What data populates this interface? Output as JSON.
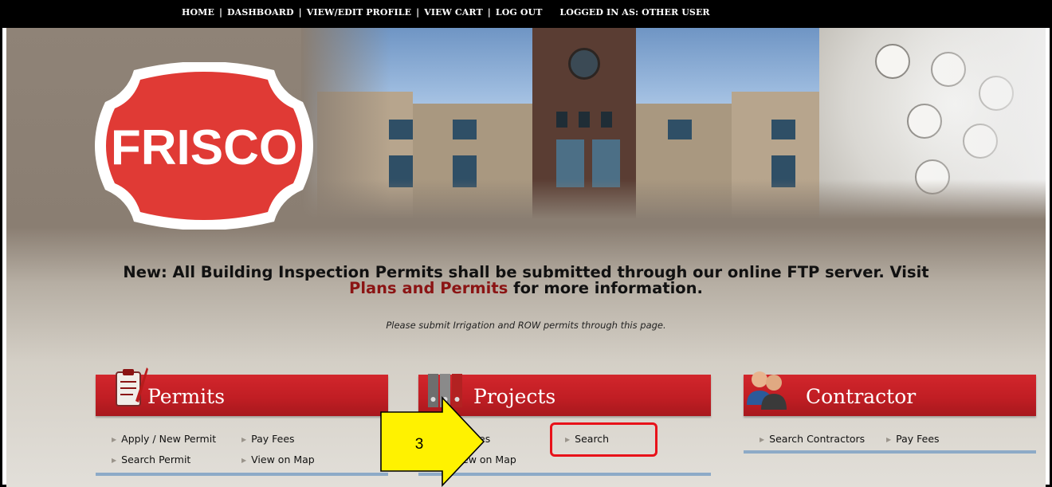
{
  "topnav": {
    "items": [
      "HOME",
      "DASHBOARD",
      "VIEW/EDIT PROFILE",
      "VIEW CART",
      "LOG OUT"
    ],
    "separator": "|",
    "logged_in_label": "LOGGED IN AS:",
    "logged_in_user": "OTHER USER"
  },
  "logo": {
    "text": "FRISCO",
    "color": "#e03a35"
  },
  "notice": {
    "line1": "New: All Building Inspection Permits shall be submitted through our online FTP server. Visit",
    "link": "Plans and Permits",
    "line2_rest": " for more information.",
    "sub": "Please submit Irrigation and ROW permits through this page."
  },
  "panels": {
    "permits": {
      "title": "Permits",
      "links": [
        "Apply / New Permit",
        "Pay Fees",
        "Search Permit",
        "View on Map"
      ]
    },
    "projects": {
      "title": "Projects",
      "links": [
        "es",
        "Search",
        "ew on Map"
      ]
    },
    "contractor": {
      "title": "Contractor",
      "links": [
        "Search Contractors",
        "Pay Fees"
      ]
    }
  },
  "annotation": {
    "step": "3",
    "arrow_color": "#fff200",
    "highlight_color": "#e8121a"
  }
}
